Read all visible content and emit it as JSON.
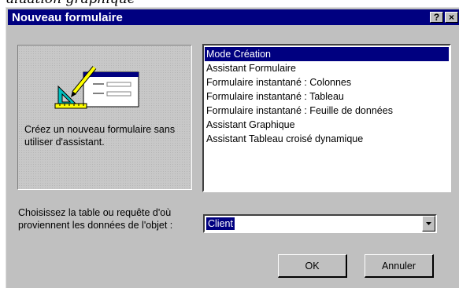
{
  "header_fragment": "aluation graphique",
  "dialog": {
    "title": "Nouveau formulaire",
    "help_button": "?",
    "close_button": "×"
  },
  "preview": {
    "icon": "form-design-icon",
    "description": "Créez un nouveau formulaire sans utiliser d'assistant."
  },
  "form_types": {
    "selected_index": 0,
    "items": [
      "Mode Création",
      "Assistant Formulaire",
      "Formulaire instantané : Colonnes",
      "Formulaire instantané : Tableau",
      "Formulaire instantané : Feuille de données",
      "Assistant Graphique",
      "Assistant Tableau croisé dynamique"
    ]
  },
  "source": {
    "label": "Choisissez la table ou requête d'où proviennent les données de l'objet :",
    "value": "Client"
  },
  "buttons": {
    "ok": "OK",
    "cancel": "Annuler"
  },
  "colors": {
    "titlebar": "#000080",
    "face": "#c0c0c0",
    "selection": "#000080"
  }
}
